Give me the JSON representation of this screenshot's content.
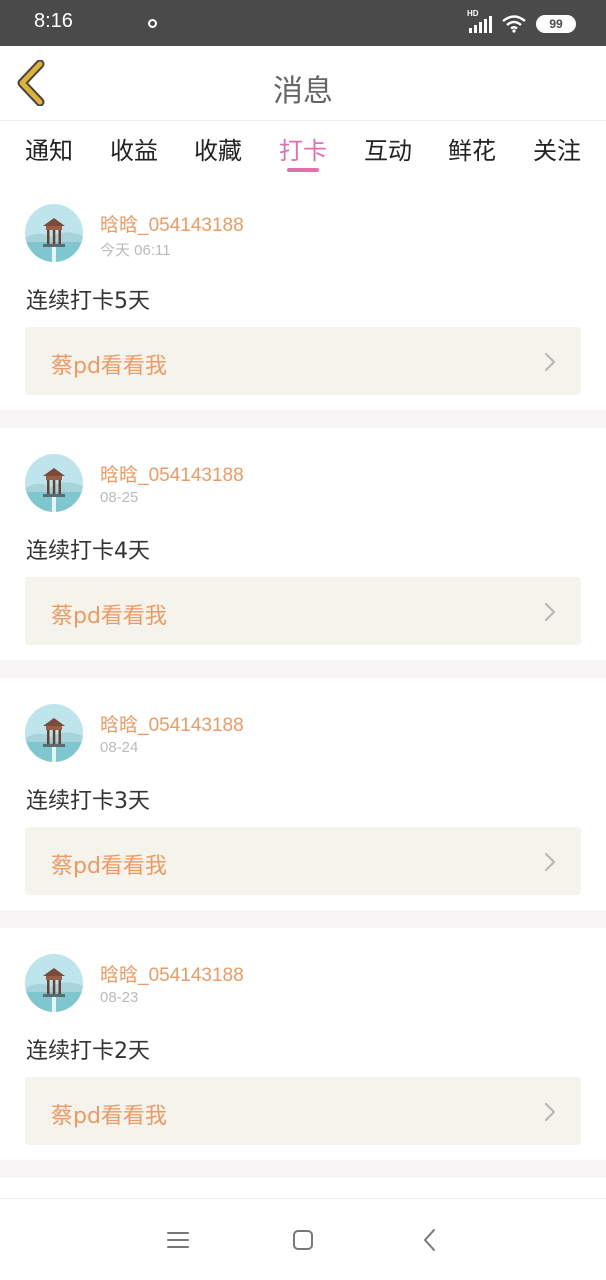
{
  "status": {
    "time": "8:16",
    "hd": "HD",
    "battery": "99"
  },
  "header": {
    "title": "消息",
    "back_icon": "chevron-left-icon",
    "back_color": "#e0b233"
  },
  "tabs": [
    {
      "label": "通知",
      "active": false
    },
    {
      "label": "收益",
      "active": false
    },
    {
      "label": "收藏",
      "active": false
    },
    {
      "label": "打卡",
      "active": true
    },
    {
      "label": "互动",
      "active": false
    },
    {
      "label": "鲜花",
      "active": false
    },
    {
      "label": "关注",
      "active": false
    }
  ],
  "colors": {
    "accent": "#e16fb0",
    "orange": "#ee9a63",
    "muted": "#bbbbbb",
    "box_bg": "#f4f3ec"
  },
  "messages": [
    {
      "username": "晗晗_054143188",
      "time": "今天 06:11",
      "text": "连续打卡5天",
      "action": "蔡pd看看我"
    },
    {
      "username": "晗晗_054143188",
      "time": "08-25",
      "text": "连续打卡4天",
      "action": "蔡pd看看我"
    },
    {
      "username": "晗晗_054143188",
      "time": "08-24",
      "text": "连续打卡3天",
      "action": "蔡pd看看我"
    },
    {
      "username": "晗晗_054143188",
      "time": "08-23",
      "text": "连续打卡2天",
      "action": "蔡pd看看我"
    }
  ],
  "nav": {
    "menu_icon": "menu-icon",
    "home_icon": "home-square-icon",
    "back_icon": "back-chevron-icon"
  }
}
